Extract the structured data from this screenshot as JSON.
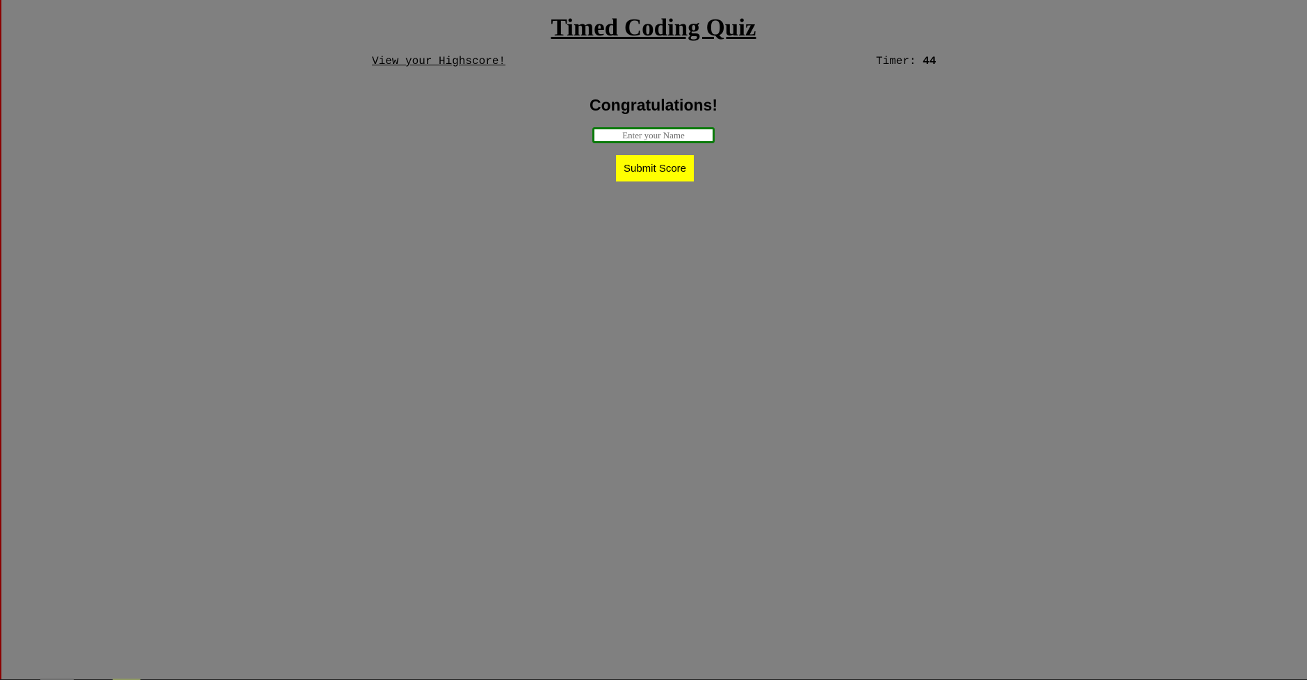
{
  "header": {
    "title": "Timed Coding Quiz",
    "highscore_link": "View your Highscore!",
    "timer_label": "Timer: ",
    "timer_value": "44"
  },
  "main": {
    "heading": "Congratulations!",
    "name_input": {
      "placeholder": "Enter your Name",
      "value": ""
    },
    "submit_label": "Submit Score"
  },
  "colors": {
    "background": "#808080",
    "submit_button": "#ffff00",
    "input_border": "#0a7a0a"
  }
}
